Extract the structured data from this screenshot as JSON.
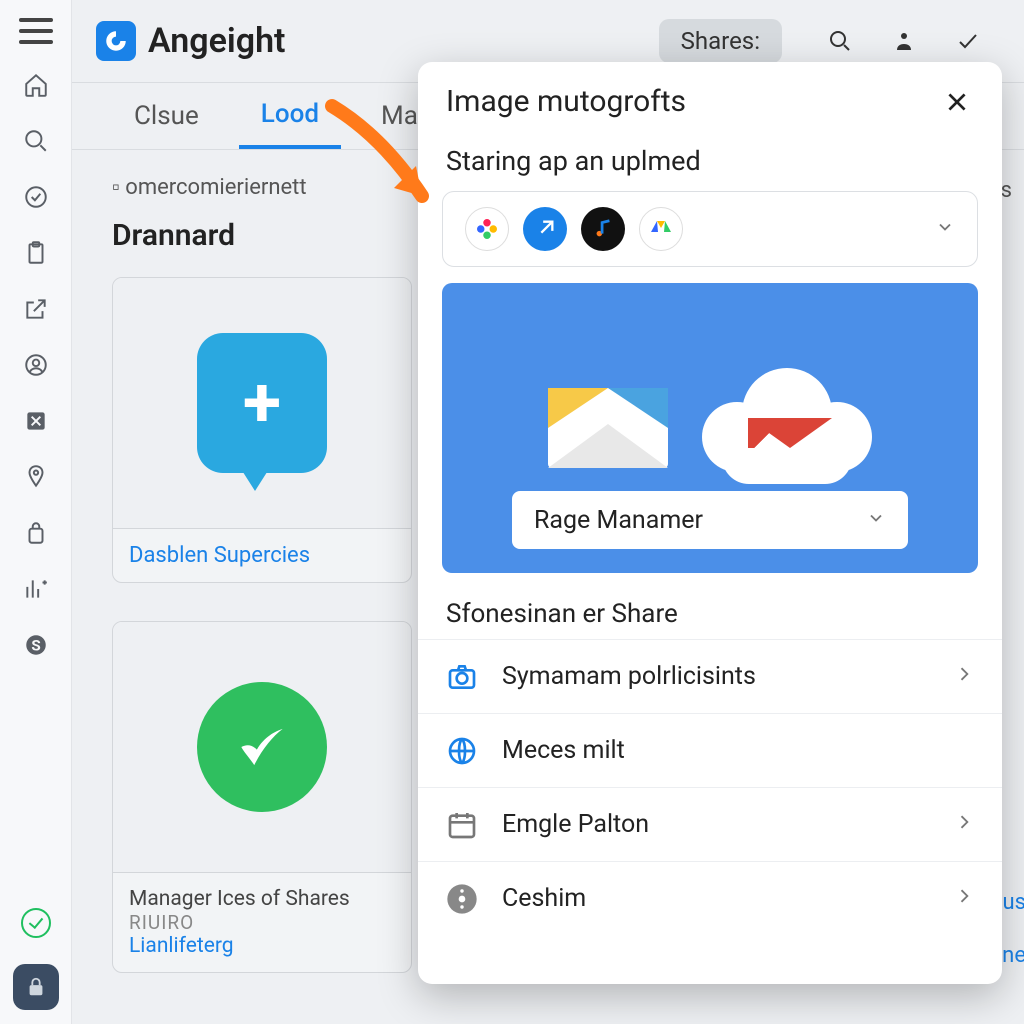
{
  "brand": "Angeight",
  "header": {
    "shares_label": "Shares:"
  },
  "tabs": [
    {
      "label": "Clsue"
    },
    {
      "label": "Lood"
    },
    {
      "label": "Masome"
    }
  ],
  "breadcrumb": "omercomieriernett",
  "breadcrumb_right": "ks",
  "section1": "Drannard",
  "cards": [
    {
      "caption": "Dasblen Supercies"
    },
    {
      "title": "Manager Ices of Shares",
      "sub": "RIUIRO",
      "link": "Lianlifeterg"
    }
  ],
  "rt1": "us",
  "rt2": "ne",
  "modal": {
    "title": "Image mutogrofts",
    "subheading": "Staring ap an uplmed",
    "hero_select": "Rage Manamer",
    "section2": "Sfonesinan er Share",
    "rows": [
      {
        "label": "Symamam polrlicisints",
        "icon": "camera",
        "chevron": true
      },
      {
        "label": "Meces milt",
        "icon": "globe",
        "chevron": false
      },
      {
        "label": "Emgle Palton",
        "icon": "calendar",
        "chevron": true
      },
      {
        "label": "Ceshim",
        "icon": "info",
        "chevron": true
      }
    ]
  }
}
